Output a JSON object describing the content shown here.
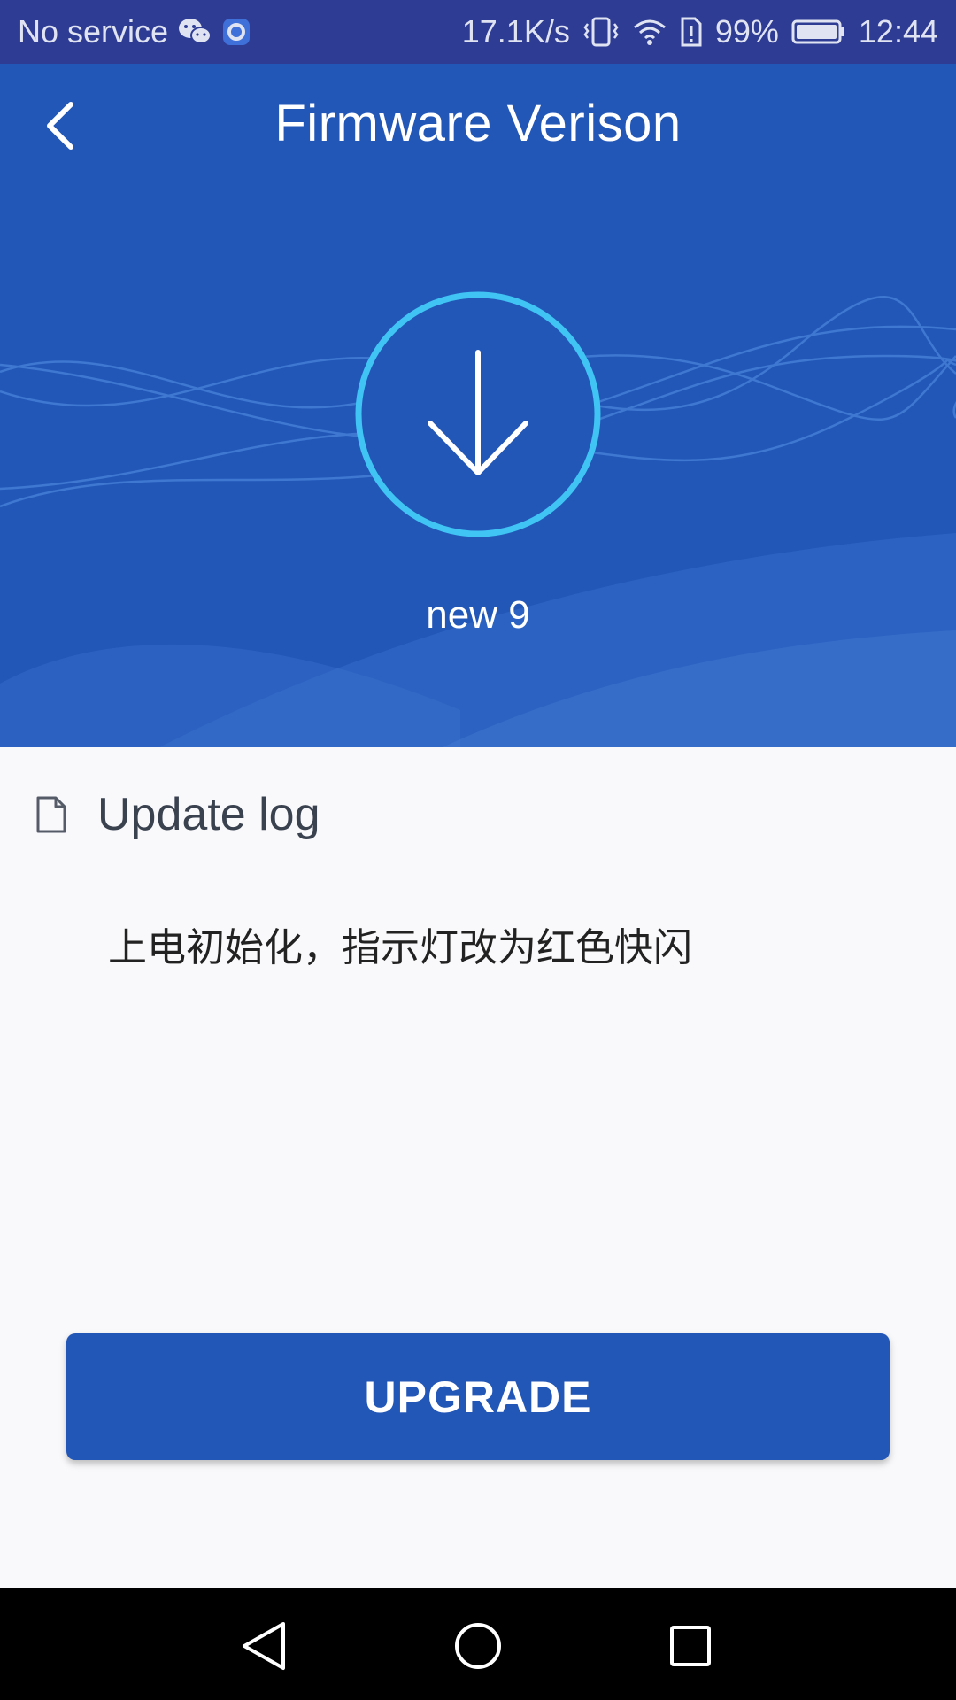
{
  "status_bar": {
    "carrier": "No service",
    "net_speed": "17.1K/s",
    "battery": "99%",
    "time": "12:44"
  },
  "header": {
    "title": "Firmware Verison",
    "version": "new 9"
  },
  "update_log": {
    "heading": "Update log",
    "text": "上电初始化，指示灯改为红色快闪"
  },
  "upgrade_label": "UPGRADE",
  "colors": {
    "primary": "#2257b8",
    "status_bar": "#2e3c94",
    "ring": "#3fc4f4",
    "background": "#f9f9fb"
  },
  "icons": [
    "wechat-icon",
    "notification-icon",
    "vibrate-icon",
    "wifi-icon",
    "sim-alert-icon",
    "battery-icon",
    "back-arrow-icon",
    "download-arrow-icon",
    "document-icon",
    "nav-back-icon",
    "nav-home-icon",
    "nav-recents-icon"
  ]
}
